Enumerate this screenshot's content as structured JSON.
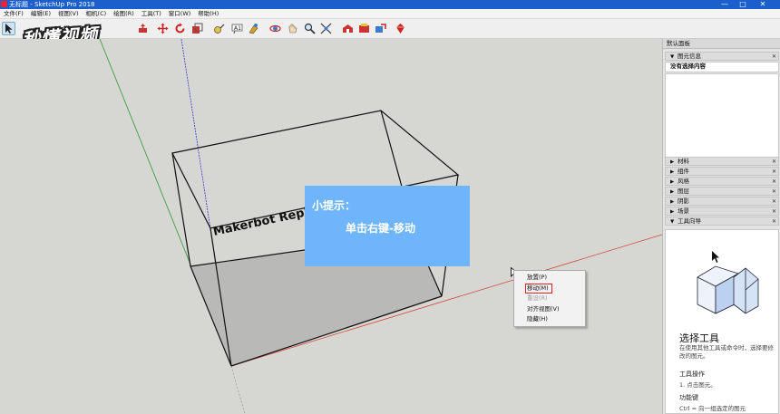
{
  "window": {
    "title": "无标题 - SketchUp Pro 2018",
    "minimize": "—",
    "maximize": "□",
    "close": "✕"
  },
  "menubar": {
    "items": [
      "文件(F)",
      "编辑(E)",
      "视图(V)",
      "相机(C)",
      "绘图(R)",
      "工具(T)",
      "窗口(W)",
      "帮助(H)"
    ]
  },
  "toolbar": {
    "icons": [
      "select-icon",
      "eraser-icon",
      "paint-bucket-icon",
      "line-icon",
      "rectangle-icon",
      "circle-icon",
      "arc-icon",
      "push-pull-icon",
      "move-icon",
      "rotate-icon",
      "scale-icon",
      "tape-measure-icon",
      "text-icon",
      "paint-icon",
      "orbit-icon",
      "pan-icon",
      "zoom-icon",
      "zoom-extents-icon",
      "warehouse-icon",
      "extension-icon",
      "share-icon",
      "ruby-icon"
    ]
  },
  "watermark": {
    "text": "秒懂视频"
  },
  "viewport": {
    "model_label": "Makerbot Repli",
    "tip": {
      "title": "小提示：",
      "body": "单击右键-移动"
    },
    "context_menu": {
      "items": [
        {
          "label": "放置(P)",
          "state": "normal"
        },
        {
          "label": "移动(M)",
          "state": "highlighted"
        },
        {
          "label": "重设(R)",
          "state": "disabled"
        },
        {
          "label": "对齐视图(V)",
          "state": "normal"
        },
        {
          "label": "隐藏(H)",
          "state": "normal"
        }
      ]
    },
    "colors": {
      "background": "#d6d6d3",
      "red_axis": "#d2483a",
      "green_axis": "#2f9a2f",
      "blue_axis": "#3a3acc",
      "tip_background": "#6eb5fb",
      "highlight_border": "#e02020"
    }
  },
  "tray": {
    "title": "默认面板",
    "entity_info": {
      "header": "图元信息",
      "text": "没有选择内容"
    },
    "sections": [
      "材料",
      "组件",
      "风格",
      "图层",
      "阴影",
      "场景",
      "工具向导"
    ],
    "instructor": {
      "tool_title": "选择工具",
      "description": "在使用其他工具或命令时，选择要修改的图元。",
      "operation_heading": "工具操作",
      "operation_text": "1. 点击图元。",
      "modifier_heading": "功能键",
      "modifier_text": "Ctrl = 向一组选定的图元"
    }
  }
}
